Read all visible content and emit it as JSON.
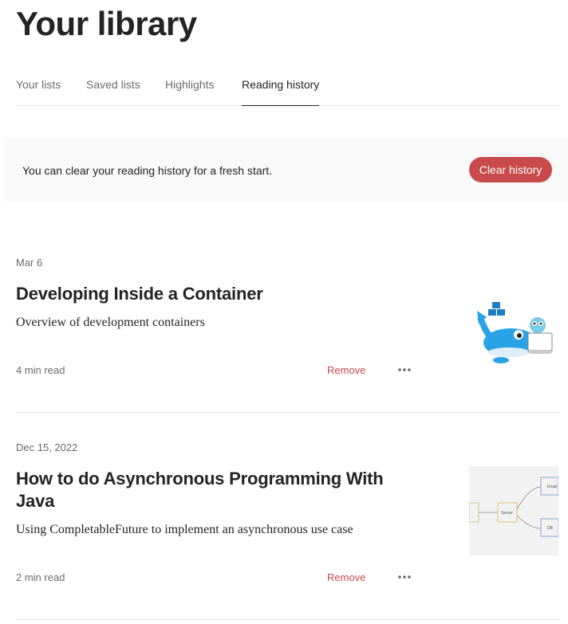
{
  "page": {
    "title": "Your library"
  },
  "tabs": [
    {
      "label": "Your lists",
      "active": false
    },
    {
      "label": "Saved lists",
      "active": false
    },
    {
      "label": "Highlights",
      "active": false
    },
    {
      "label": "Reading history",
      "active": true
    }
  ],
  "banner": {
    "text": "You can clear your reading history for a fresh start.",
    "button_label": "Clear history"
  },
  "articles": [
    {
      "date": "Mar 6",
      "title": "Developing Inside a Container",
      "subtitle": "Overview of development containers",
      "read_time": "4 min read",
      "remove_label": "Remove",
      "thumbnail": "docker-whale-gopher-illustration"
    },
    {
      "date": "Dec 15, 2022",
      "title": "How to do Asynchronous Programming With Java",
      "subtitle": "Using CompletableFuture to implement an asynchronous use case",
      "read_time": "2 min read",
      "remove_label": "Remove",
      "thumbnail": "client-server-email-db-flow-diagram",
      "diagram_labels": [
        "Server",
        "Email",
        "DB"
      ]
    }
  ],
  "colors": {
    "accent_red": "#c94a4a",
    "text_primary": "#242424",
    "text_secondary": "#6b6b6b",
    "divider": "#e6e6e6",
    "banner_bg": "#f9f9f9"
  }
}
